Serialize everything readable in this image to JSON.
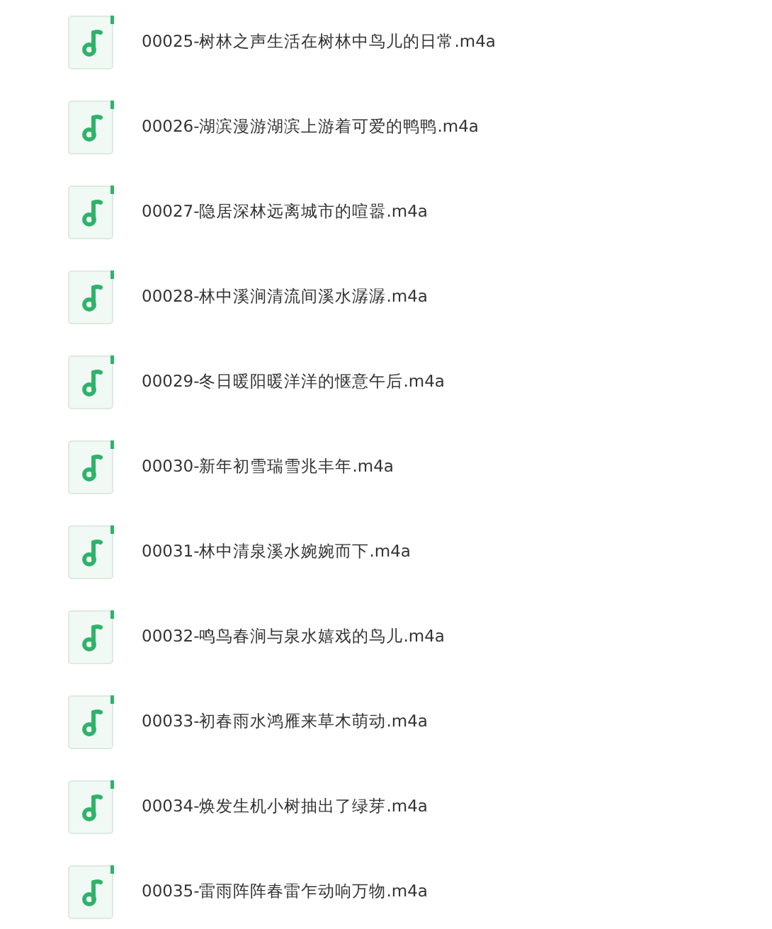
{
  "files": [
    {
      "name": "00025-树林之声生活在树林中鸟儿的日常.m4a"
    },
    {
      "name": "00026-湖滨漫游湖滨上游着可爱的鸭鸭.m4a"
    },
    {
      "name": "00027-隐居深林远离城市的喧嚣.m4a"
    },
    {
      "name": "00028-林中溪涧清流间溪水潺潺.m4a"
    },
    {
      "name": "00029-冬日暖阳暖洋洋的惬意午后.m4a"
    },
    {
      "name": "00030-新年初雪瑞雪兆丰年.m4a"
    },
    {
      "name": "00031-林中清泉溪水婉婉而下.m4a"
    },
    {
      "name": "00032-鸣鸟春涧与泉水嬉戏的鸟儿.m4a"
    },
    {
      "name": "00033-初春雨水鸿雁来草木萌动.m4a"
    },
    {
      "name": "00034-焕发生机小树抽出了绿芽.m4a"
    },
    {
      "name": "00035-雷雨阵阵春雷乍动响万物.m4a"
    }
  ]
}
